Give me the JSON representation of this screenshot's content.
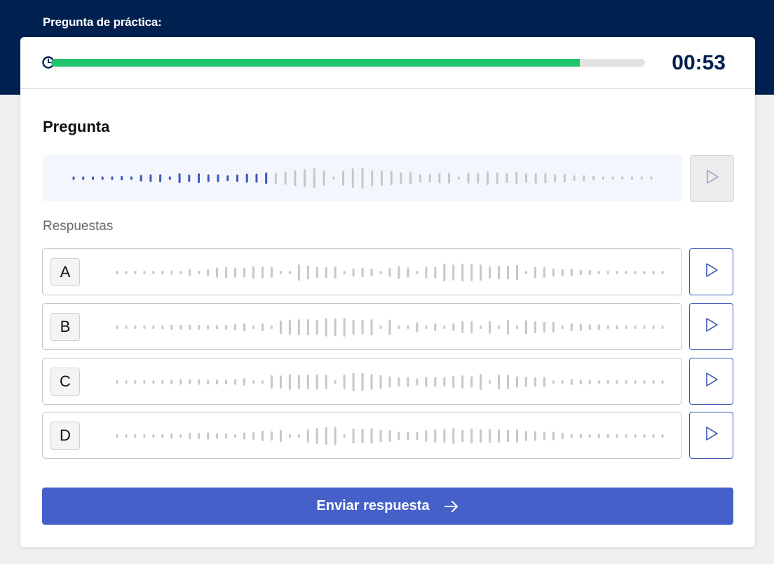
{
  "header": {
    "label": "Pregunta de práctica:"
  },
  "timer": {
    "value": "00:53",
    "progress": 0.89
  },
  "question": {
    "title": "Pregunta",
    "played_fraction": 0.34
  },
  "answers": {
    "title": "Respuestas",
    "items": [
      {
        "letter": "A"
      },
      {
        "letter": "B"
      },
      {
        "letter": "C"
      },
      {
        "letter": "D"
      }
    ]
  },
  "submit": {
    "label": "Enviar respuesta"
  },
  "colors": {
    "navy": "#00204f",
    "progress_green": "#22c46e",
    "accent_blue": "#4560c8",
    "wave_played": "#3e57b8",
    "wave_unplayed": "#c7c7c7"
  },
  "icons": {
    "timer": "clock-icon",
    "play": "play-icon",
    "submit": "arrow-right-icon"
  }
}
